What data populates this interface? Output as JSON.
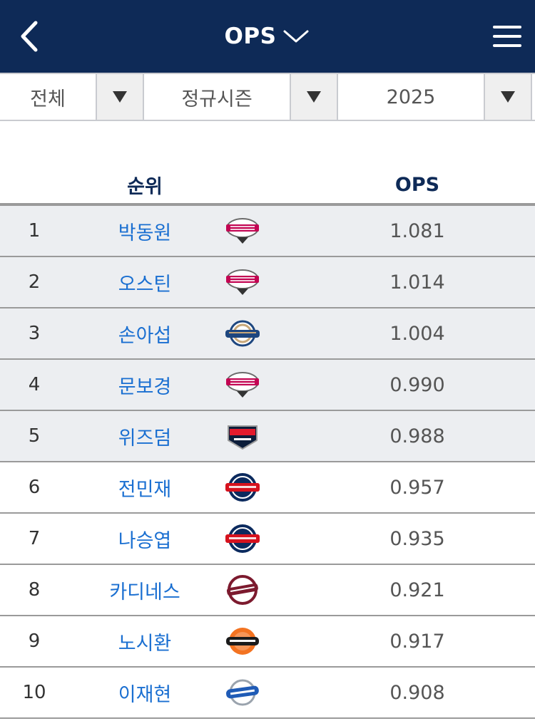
{
  "header": {
    "title": "OPS",
    "back_icon": "chevron-left-icon",
    "menu_icon": "hamburger-menu-icon",
    "title_dropdown_icon": "chevron-down-icon"
  },
  "filters": [
    {
      "value": "전체"
    },
    {
      "value": "정규시즌"
    },
    {
      "value": "2025"
    }
  ],
  "table": {
    "columns": {
      "rank_name": "순위",
      "value": "OPS"
    },
    "rows": [
      {
        "rank": "1",
        "name": "박동원",
        "team": "LG TWINS",
        "logo": "twins",
        "ops": "1.081"
      },
      {
        "rank": "2",
        "name": "오스틴",
        "team": "LG TWINS",
        "logo": "twins",
        "ops": "1.014"
      },
      {
        "rank": "3",
        "name": "손아섭",
        "team": "NC DINOS",
        "logo": "dinos",
        "ops": "1.004"
      },
      {
        "rank": "4",
        "name": "문보경",
        "team": "LG TWINS",
        "logo": "twins",
        "ops": "0.990"
      },
      {
        "rank": "5",
        "name": "위즈덤",
        "team": "KIA TIGERS",
        "logo": "tigers",
        "ops": "0.988"
      },
      {
        "rank": "6",
        "name": "전민재",
        "team": "LOTTE GIANTS",
        "logo": "giants",
        "ops": "0.957"
      },
      {
        "rank": "7",
        "name": "나승엽",
        "team": "LOTTE GIANTS",
        "logo": "giants",
        "ops": "0.935"
      },
      {
        "rank": "8",
        "name": "카디네스",
        "team": "KIWOOM HEROES",
        "logo": "kiwoom",
        "ops": "0.921"
      },
      {
        "rank": "9",
        "name": "노시환",
        "team": "HANWHA EAGLES",
        "logo": "eagles",
        "ops": "0.917"
      },
      {
        "rank": "10",
        "name": "이재현",
        "team": "SAMSUNG LIONS",
        "logo": "lions",
        "ops": "0.908"
      }
    ]
  },
  "colors": {
    "header_bg": "#0e2a57",
    "name_link": "#1a6fd1",
    "highlight_row": "#eceef1"
  }
}
